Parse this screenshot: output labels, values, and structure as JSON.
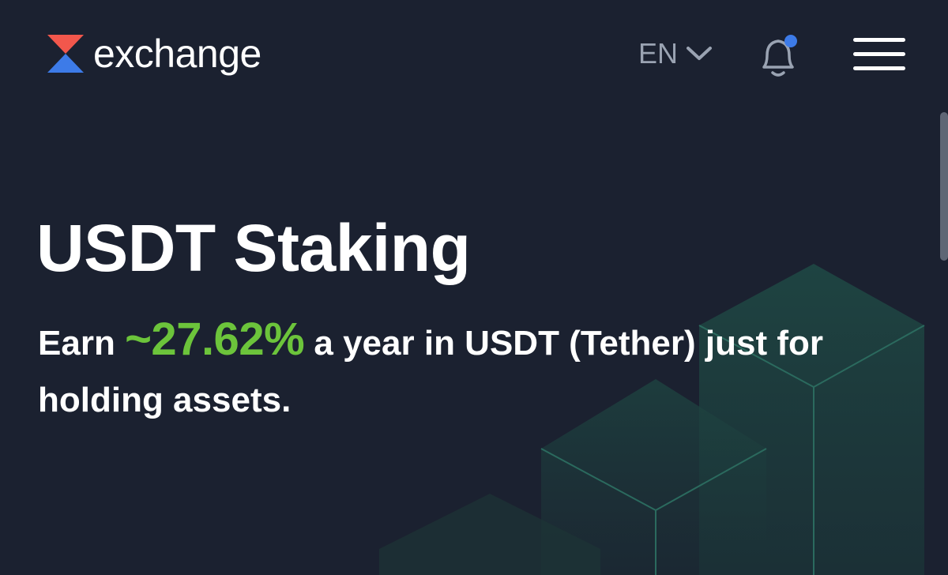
{
  "brand": {
    "name": "exchange",
    "colors": {
      "top": "#f2574c",
      "bottom": "#3d7be8"
    }
  },
  "header": {
    "language": "EN",
    "notification": {
      "has_unread": true,
      "dot_color": "#3d7be8"
    }
  },
  "hero": {
    "title": "USDT Staking",
    "subtitle_prefix": "Earn",
    "rate": "~27.62%",
    "subtitle_suffix": "a year in USDT (Tether) just for holding assets."
  },
  "colors": {
    "background": "#1b2130",
    "accent_green": "#6cc43b",
    "muted_text": "#9aa3b2"
  },
  "icons": {
    "language_chevron": "chevron-down-icon",
    "notifications": "bell-icon",
    "menu": "hamburger-menu-icon"
  }
}
